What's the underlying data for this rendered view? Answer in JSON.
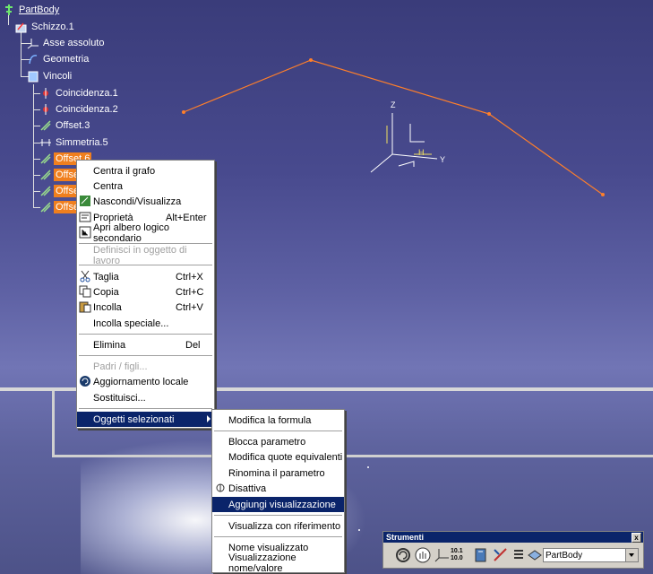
{
  "tree": {
    "root": "PartBody",
    "sketch": "Schizzo.1",
    "absolute_axis": "Asse assoluto",
    "geometry": "Geometria",
    "constraints": "Vincoli",
    "items": [
      {
        "label": "Coincidenza.1",
        "selected": false
      },
      {
        "label": "Coincidenza.2",
        "selected": false
      },
      {
        "label": "Offset.3",
        "selected": false
      },
      {
        "label": "Simmetria.5",
        "selected": false
      },
      {
        "label": "Offset.6",
        "selected": true
      },
      {
        "label": "Offset",
        "selected": true
      },
      {
        "label": "Offset",
        "selected": true
      },
      {
        "label": "Offset",
        "selected": true
      }
    ]
  },
  "axes": {
    "z": "Z",
    "y": "Y",
    "h": "H"
  },
  "context_menu": {
    "center_graph": "Centra il grafo",
    "center": "Centra",
    "hide_show": "Nascondi/Visualizza",
    "properties": "Proprietà",
    "properties_shortcut": "Alt+Enter",
    "open_secondary_tree": "Apri albero logico secondario",
    "define_work_object": "Definisci in oggetto di lavoro",
    "cut": "Taglia",
    "cut_shortcut": "Ctrl+X",
    "copy": "Copia",
    "copy_shortcut": "Ctrl+C",
    "paste": "Incolla",
    "paste_shortcut": "Ctrl+V",
    "paste_special": "Incolla speciale...",
    "delete": "Elimina",
    "delete_shortcut": "Del",
    "parents_children": "Padri / figli...",
    "local_update": "Aggiornamento locale",
    "replace": "Sostituisci...",
    "selected_objects": "Oggetti selezionati"
  },
  "submenu": {
    "edit_formula": "Modifica la formula",
    "lock_parameter": "Blocca parametro",
    "edit_equivalent_dims": "Modifica quote equivalenti",
    "rename_parameter": "Rinomina il parametro",
    "deactivate": "Disattiva",
    "add_display": "Aggiungi visualizzazione",
    "display_with_reference": "Visualizza con riferimento",
    "display_name": "Nome visualizzato",
    "display_name_value": "Visualizzazione nome/valore"
  },
  "toolbar": {
    "title": "Strumenti",
    "close": "x",
    "grid_label": "10.1\n10.0",
    "current_body": "PartBody"
  },
  "colors": {
    "background": "#484a8e",
    "selection": "#f07f1e",
    "menu_highlight": "#0a246a",
    "sketch_line": "#ff7f2a"
  }
}
